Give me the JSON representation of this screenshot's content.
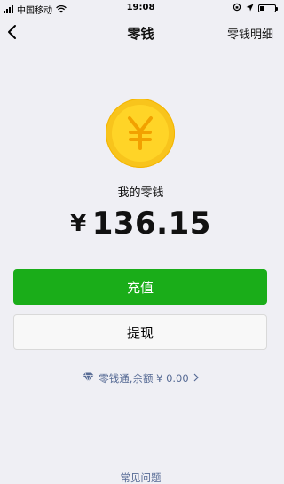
{
  "status_bar": {
    "carrier": "中国移动",
    "time": "19:08",
    "battery_level": 0.3
  },
  "nav": {
    "title": "零钱",
    "detail_link": "零钱明细"
  },
  "coin": {
    "symbol": "¥",
    "icon": "yuan-coin-icon"
  },
  "balance": {
    "label": "我的零钱",
    "currency": "¥",
    "amount": "136.15"
  },
  "actions": {
    "recharge": "充值",
    "withdraw": "提现"
  },
  "lingqiantong": {
    "text": "零钱通,余额 ¥ 0.00",
    "icon": "diamond-icon"
  },
  "faq": "常见问题",
  "colors": {
    "accent_green": "#1aad19",
    "link_blue": "#576b95",
    "coin_yellow": "#f8c41c",
    "background": "#efeff4"
  }
}
